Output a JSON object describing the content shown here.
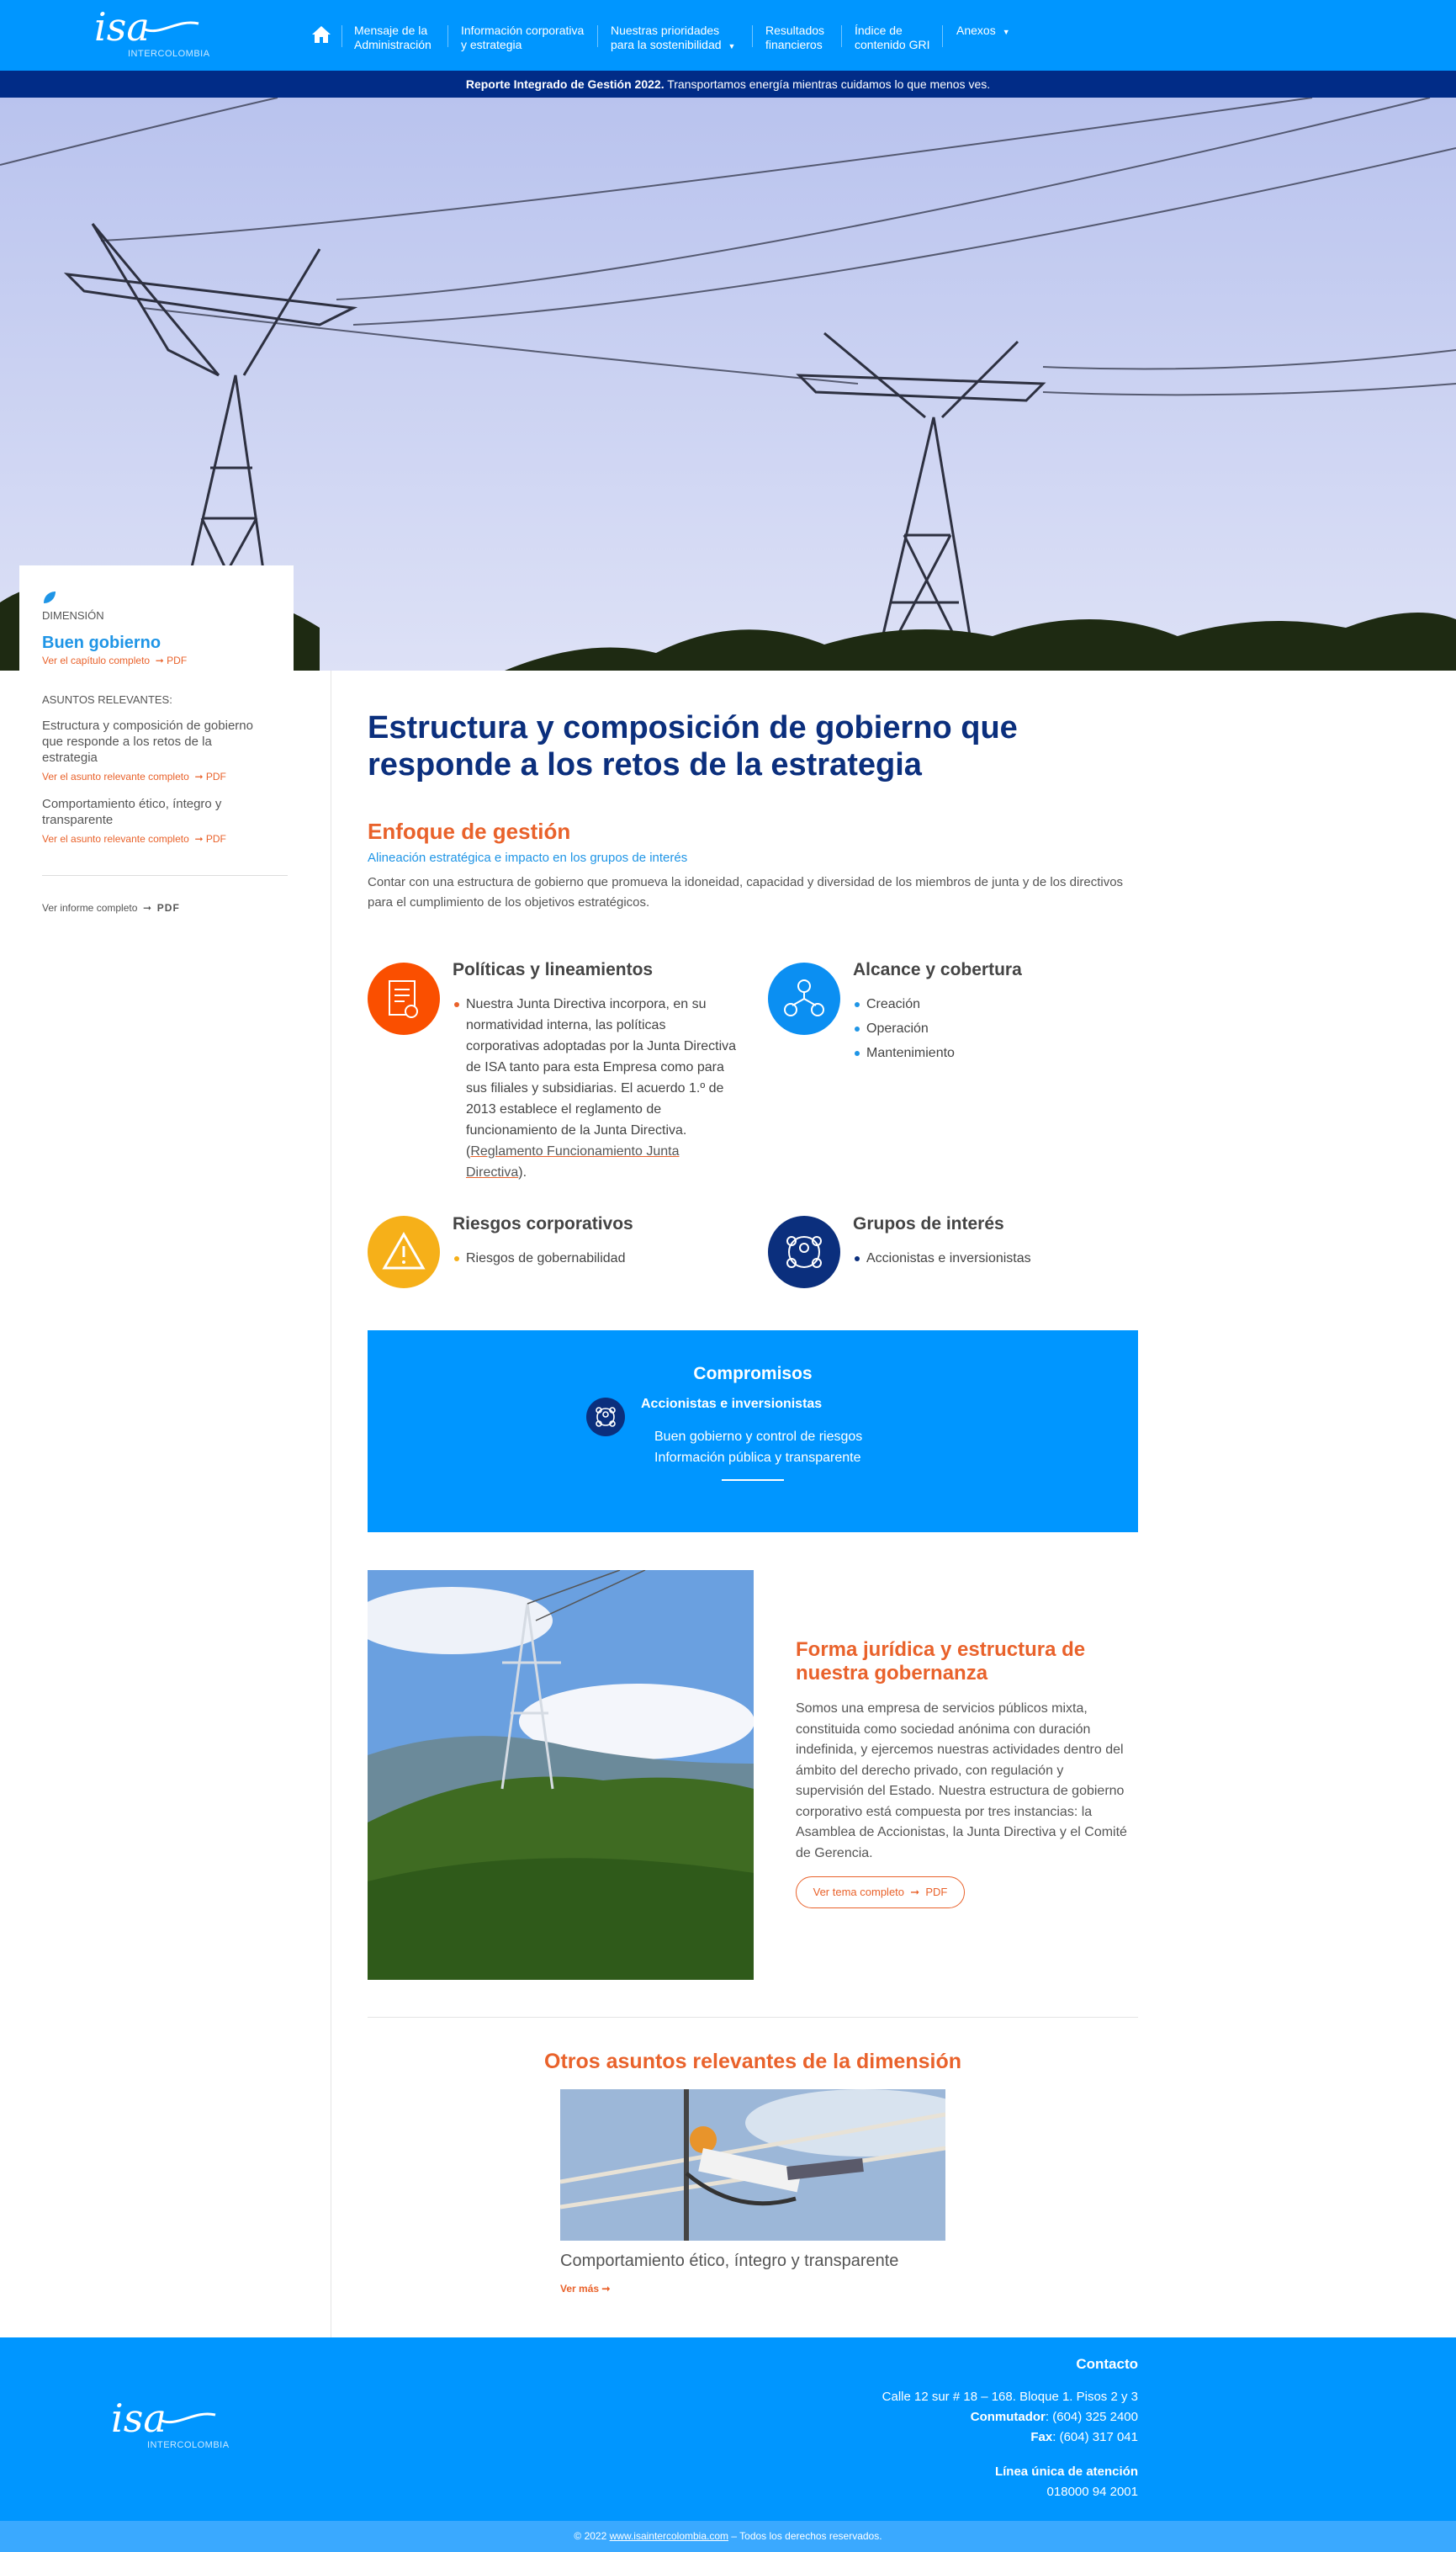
{
  "header": {
    "logo_text": "isa",
    "logo_sub": "INTERCOLOMBIA",
    "nav": [
      {
        "line1": "Mensaje de la",
        "line2": "Administración"
      },
      {
        "line1": "Información corporativa",
        "line2": "y estrategia"
      },
      {
        "line1": "Nuestras prioridades",
        "line2": "para la sostenibilidad"
      },
      {
        "line1": "Resultados",
        "line2": "financieros"
      },
      {
        "line1": "Índice de",
        "line2": "contenido GRI"
      },
      {
        "line1": "Anexos",
        "line2": ""
      }
    ]
  },
  "banner": {
    "bold": "Reporte Integrado de Gestión 2022.",
    "text": " Transportamos energía mientras cuidamos lo que menos ves."
  },
  "sidebar": {
    "dimension_label": "DIMENSIÓN",
    "dimension_title": "Buen gobierno",
    "chapter_link": "Ver el capítulo completo",
    "pdf": "PDF",
    "relevant_label": "ASUNTOS RELEVANTES:",
    "items": [
      {
        "title": "Estructura y composición de gobierno que responde a los retos de la estrategia",
        "link": "Ver el asunto relevante completo"
      },
      {
        "title": "Comportamiento ético, íntegro y transparente",
        "link": "Ver el asunto relevante completo"
      }
    ],
    "report_link": "Ver informe completo",
    "report_pdf": "PDF"
  },
  "main": {
    "title": "Estructura y composición de gobierno que responde a los retos de la estrategia",
    "focus_title": "Enfoque de gestión",
    "focus_sub": "Alineación estratégica e impacto en los grupos de interés",
    "focus_text": "Contar con una estructura de gobierno que promueva la idoneidad, capacidad y diversidad de los miembros de junta y de los directivos para el cumplimiento de los objetivos estratégicos.",
    "policies": {
      "title": "Políticas y lineamientos",
      "text": "Nuestra Junta Directiva incorpora, en su normatividad interna, las políticas corporativas adoptadas por la Junta Directiva de ISA tanto para esta Empresa como para sus filiales y subsidiarias. El acuerdo 1.º de 2013 establece el reglamento de funcionamiento de la Junta Directiva. (",
      "link": "Reglamento Funcionamiento Junta Directiva",
      "after": ")."
    },
    "scope": {
      "title": "Alcance y cobertura",
      "items": [
        "Creación",
        "Operación",
        "Mantenimiento"
      ]
    },
    "risks": {
      "title": "Riesgos corporativos",
      "items": [
        "Riesgos de gobernabilidad"
      ]
    },
    "groups": {
      "title": "Grupos de interés",
      "items": [
        "Accionistas e inversionistas"
      ]
    },
    "commitments": {
      "title": "Compromisos",
      "group": "Accionistas e inversionistas",
      "items": [
        "Buen gobierno y control de riesgos",
        "Información pública y transparente"
      ]
    },
    "legal": {
      "title": "Forma jurídica y estructura de nuestra gobernanza",
      "text": "Somos una empresa de servicios públicos mixta, constituida como sociedad anónima con duración indefinida, y ejercemos nuestras actividades dentro del ámbito del derecho privado, con regulación y supervisión del Estado. Nuestra estructura de gobierno corporativo está compuesta por tres instancias: la Asamblea de Accionistas, la Junta Directiva y el Comité de Gerencia.",
      "button": "Ver tema completo",
      "pdf": "PDF"
    },
    "others": {
      "title": "Otros asuntos relevantes de la dimensión",
      "card_title": "Comportamiento ético, íntegro y transparente",
      "more": "Ver más"
    }
  },
  "footer": {
    "contact_title": "Contacto",
    "address": "Calle 12 sur # 18 – 168. Bloque 1. Pisos 2 y 3",
    "switch_label": "Conmutador",
    "switch_value": ": (604) 325 2400",
    "fax_label": "Fax",
    "fax_value": ": (604) 317 041",
    "line_title": "Línea única de atención",
    "line_value": "018000 94 2001",
    "copyright_pre": "© 2022 ",
    "copyright_link": "www.isaintercolombia.com",
    "copyright_post": " – Todos los derechos reservados."
  },
  "colors": {
    "primary": "#0096ff",
    "navy": "#0b2f7d",
    "orange": "#e9622b",
    "yellow": "#f6b019",
    "banner": "#012c87"
  }
}
